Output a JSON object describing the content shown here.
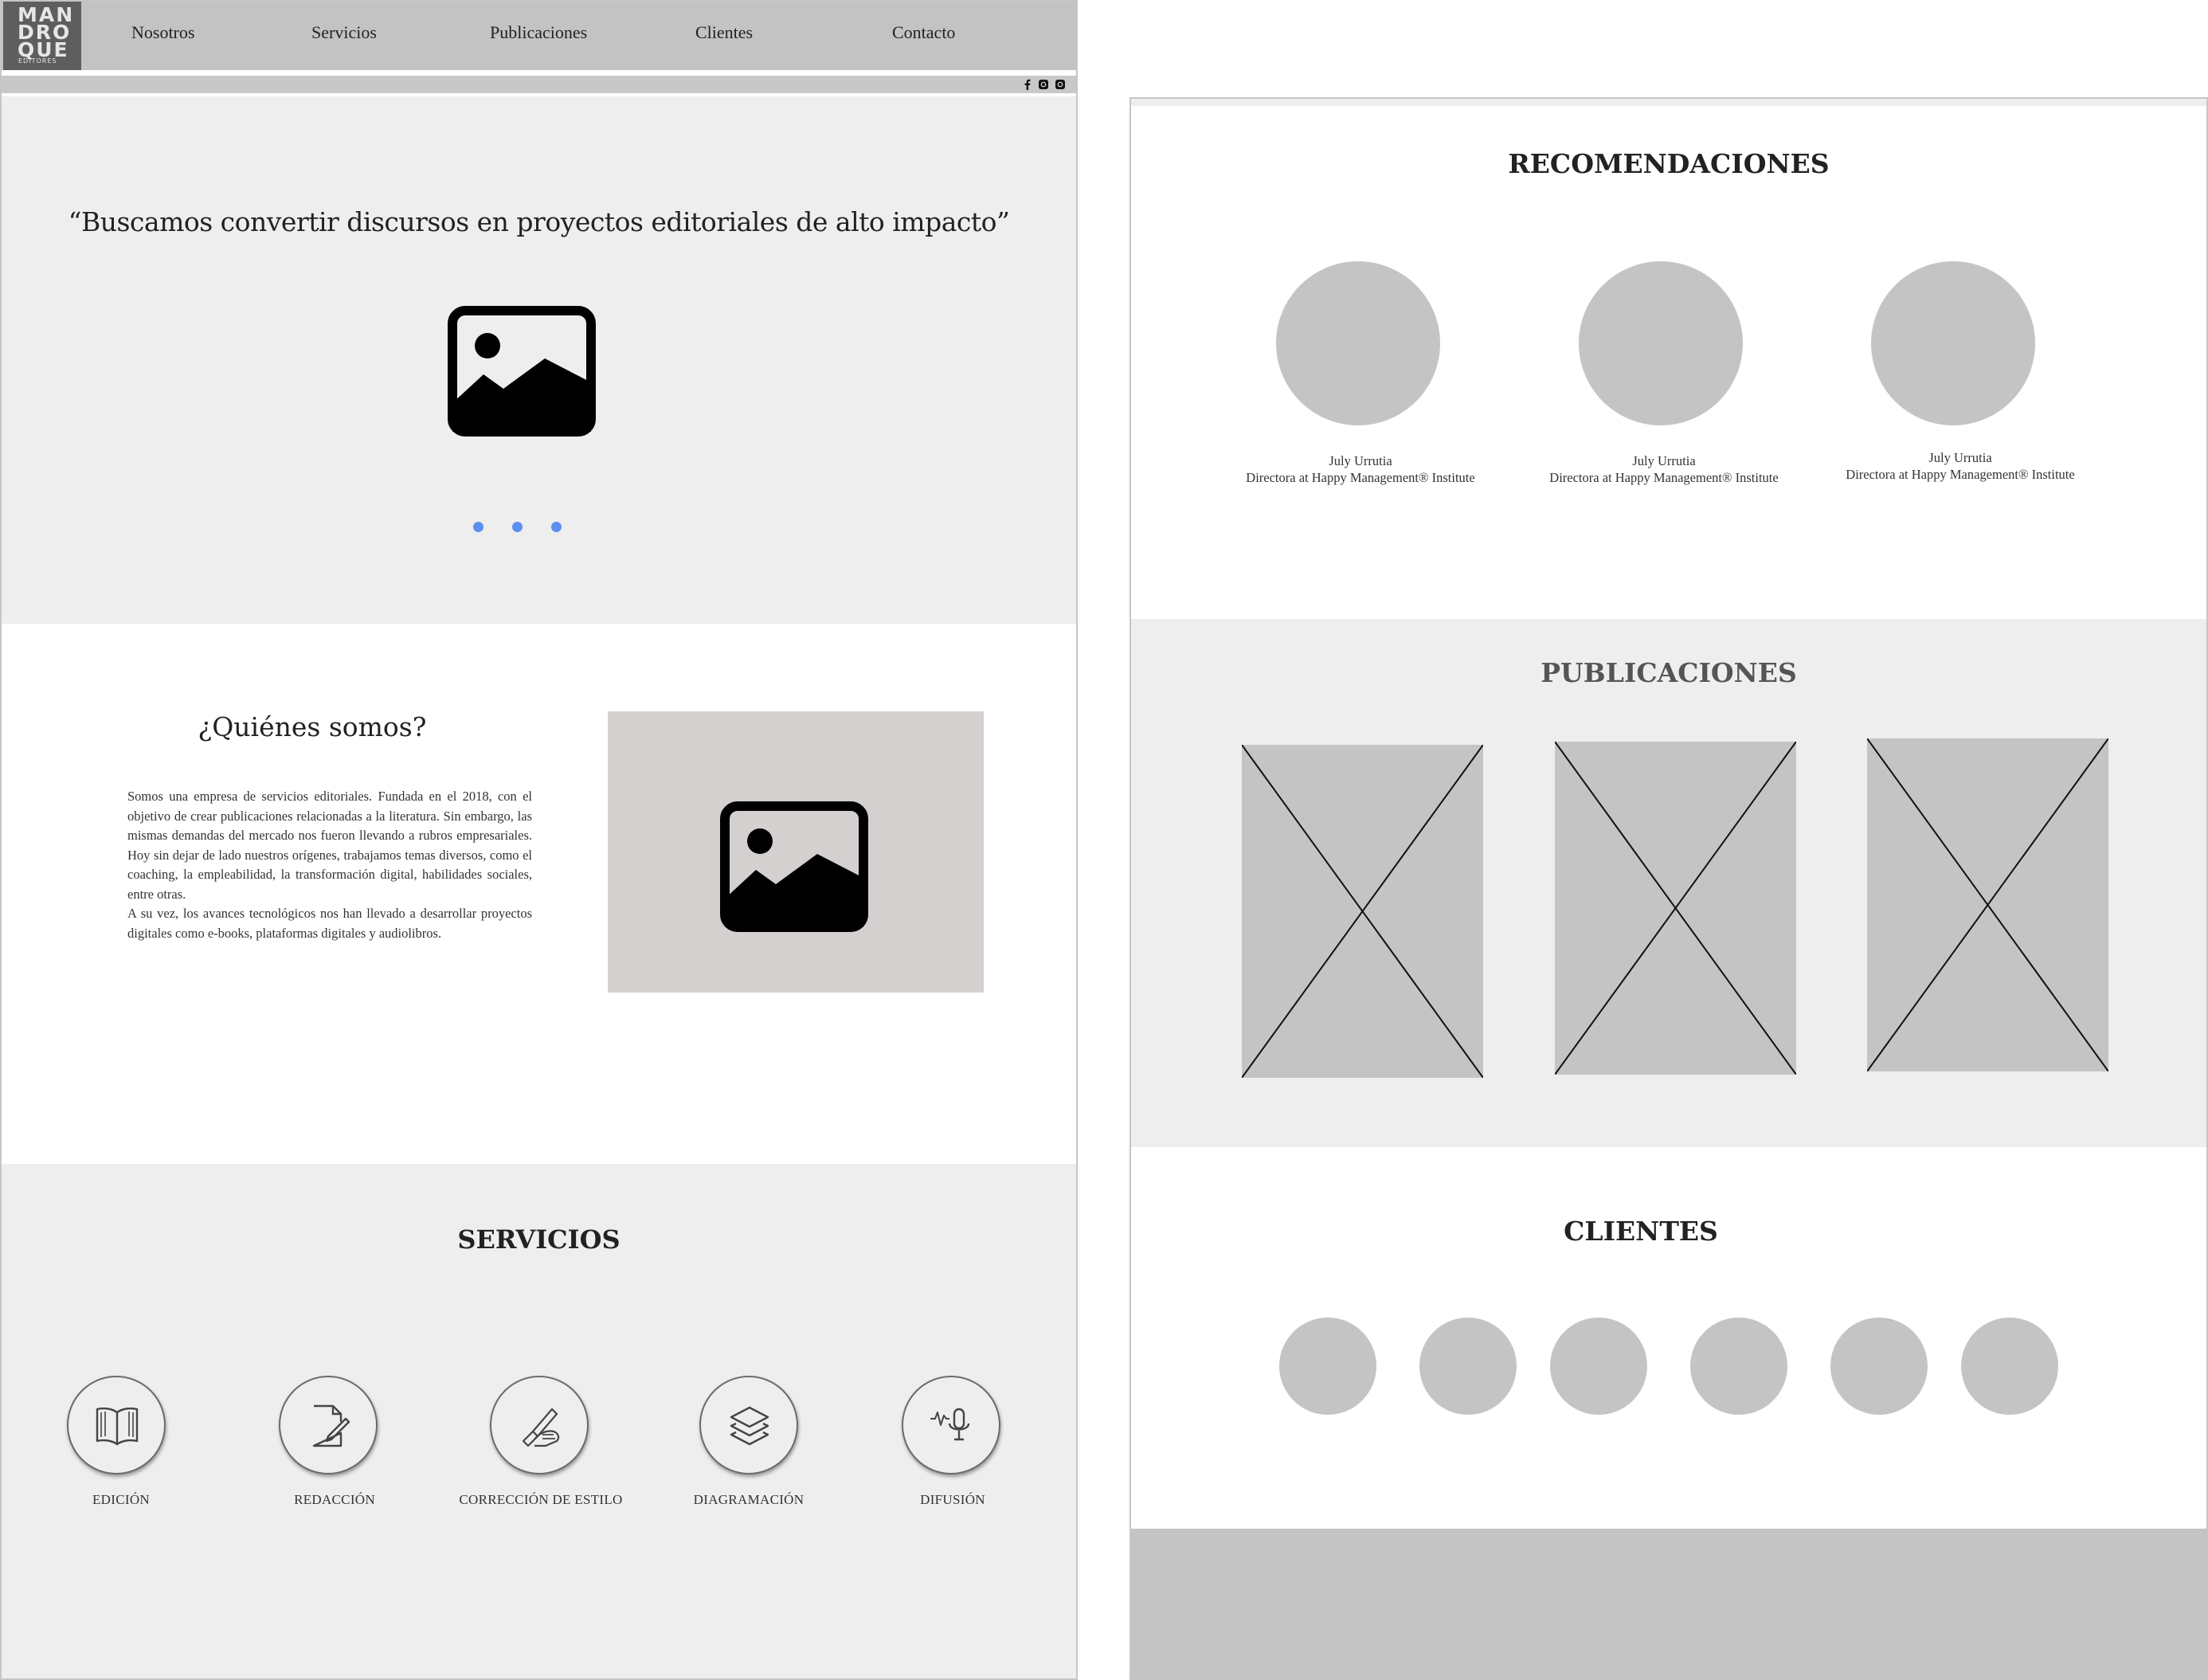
{
  "logo": {
    "line1": "MAN",
    "line2": "DRO",
    "line3": "QUE",
    "line4": "EDITORES"
  },
  "nav": [
    "Nosotros",
    "Servicios",
    "Publicaciones",
    "Clientes",
    "Contacto"
  ],
  "social": {
    "icons": [
      "facebook-icon",
      "instagram-icon",
      "instagram-icon"
    ],
    "labels": [
      "f",
      "◎",
      "◎"
    ]
  },
  "hero": {
    "quote": "“Buscamos convertir discursos en proyectos editoriales de alto impacto”",
    "image_icon": "image-icon",
    "carousel_dots": 3,
    "dot_color": "#5b8ff0"
  },
  "about": {
    "title": "¿Quiénes somos?",
    "paragraph1": "Somos una empresa de servicios editoriales. Fundada en el 2018, con el objetivo de crear publicaciones relacionadas a la literatura. Sin embargo, las mismas demandas del mercado nos fueron llevando a rubros empresariales. Hoy sin dejar de lado nuestros orígenes, trabajamos temas diversos, como el coaching, la empleabilidad, la transformación digital, habilidades sociales, entre otras.",
    "paragraph2": "A su vez, los avances tecnológicos nos han llevado a desarrollar proyectos digitales como e-books, plataformas digitales y audiolibros.",
    "image_icon": "image-icon"
  },
  "services": {
    "title": "SERVICIOS",
    "items": [
      {
        "label": "EDICIÓN",
        "icon": "open-book-icon"
      },
      {
        "label": "REDACCIÓN",
        "icon": "document-pen-icon"
      },
      {
        "label": "CORRECCIÓN DE ESTILO",
        "icon": "hand-writing-icon"
      },
      {
        "label": "DIAGRAMACIÓN",
        "icon": "layers-icon"
      },
      {
        "label": "DIFUSIÓN",
        "icon": "microphone-icon"
      }
    ]
  },
  "recommendations": {
    "title": "RECOMENDACIONES",
    "items": [
      {
        "name": "July Urrutia",
        "role": "Directora at Happy Management® Institute"
      },
      {
        "name": "July Urrutia",
        "role": "Directora at Happy Management® Institute"
      },
      {
        "name": "July Urrutia",
        "role": "Directora at Happy Management® Institute"
      }
    ]
  },
  "publications": {
    "title": "PUBLICACIONES",
    "count": 3
  },
  "clients": {
    "title": "CLIENTES",
    "count": 6
  },
  "colors": {
    "header": "#c3c3c3",
    "section_gray": "#eeeeee",
    "placeholder": "#c4c4c4",
    "image_box": "#d5d0d0",
    "logo_bg": "#5e5e5e"
  }
}
